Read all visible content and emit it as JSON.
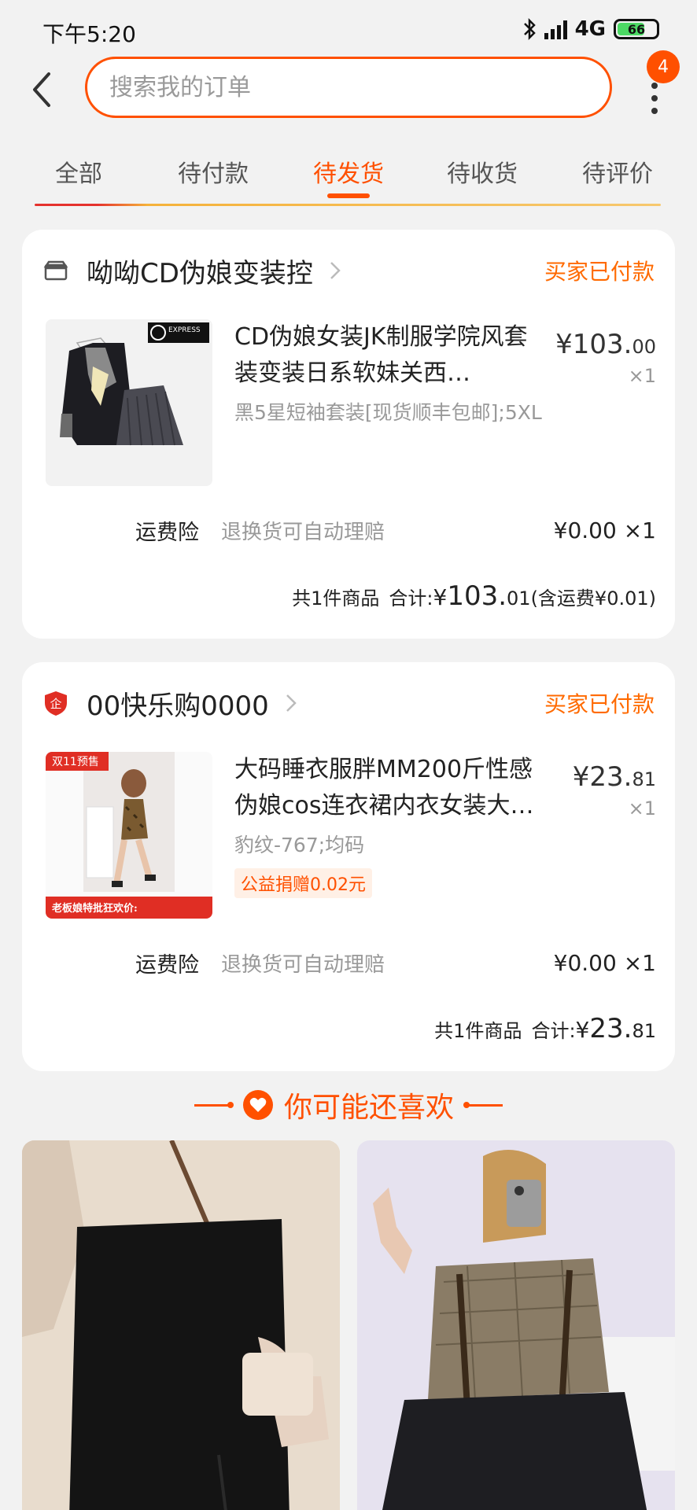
{
  "status_bar": {
    "time": "下午5:20",
    "network": "4G",
    "battery": "66"
  },
  "header": {
    "search_placeholder": "搜索我的订单",
    "badge_count": "4"
  },
  "tabs": [
    {
      "label": "全部",
      "active": false
    },
    {
      "label": "待付款",
      "active": false
    },
    {
      "label": "待发货",
      "active": true
    },
    {
      "label": "待收货",
      "active": false
    },
    {
      "label": "待评价",
      "active": false
    }
  ],
  "orders": [
    {
      "shop_name": "呦呦CD伪娘变装控",
      "status": "买家已付款",
      "product": {
        "title": "CD伪娘女装JK制服学院风套装变装日系软妹关西…",
        "spec": "黑5星短袖套装[现货顺丰包邮];5XL",
        "price_int": "¥103.",
        "price_dec": "00",
        "qty": "×1",
        "thumb_badge": "EXPRESS"
      },
      "insurance": {
        "label": "运费险",
        "desc": "退换货可自动理赔",
        "price": "¥0.00 ×1"
      },
      "total": {
        "count": "共1件商品",
        "label": "合计:",
        "yen": "¥",
        "int": "103.",
        "dec": "01",
        "shipping": "(含运费¥0.01)"
      }
    },
    {
      "shop_name": "00快乐购0000",
      "status": "买家已付款",
      "product": {
        "title": "大码睡衣服胖MM200斤性感伪娘cos连衣裙内衣女装大…",
        "spec": "豹纹-767;均码",
        "charity": "公益捐赠0.02元",
        "price_int": "¥23.",
        "price_dec": "81",
        "qty": "×1",
        "thumb_tag": "双11预售",
        "thumb_banner": "老板娘特批狂欢价:"
      },
      "insurance": {
        "label": "运费险",
        "desc": "退换货可自动理赔",
        "price": "¥0.00 ×1"
      },
      "total": {
        "count": "共1件商品",
        "label": "合计:",
        "yen": "¥",
        "int": "23.",
        "dec": "81",
        "shipping": ""
      }
    }
  ],
  "recommend": {
    "title": "你可能还喜欢"
  },
  "colors": {
    "accent": "#ff5000",
    "status_orange": "#ff6a00"
  }
}
